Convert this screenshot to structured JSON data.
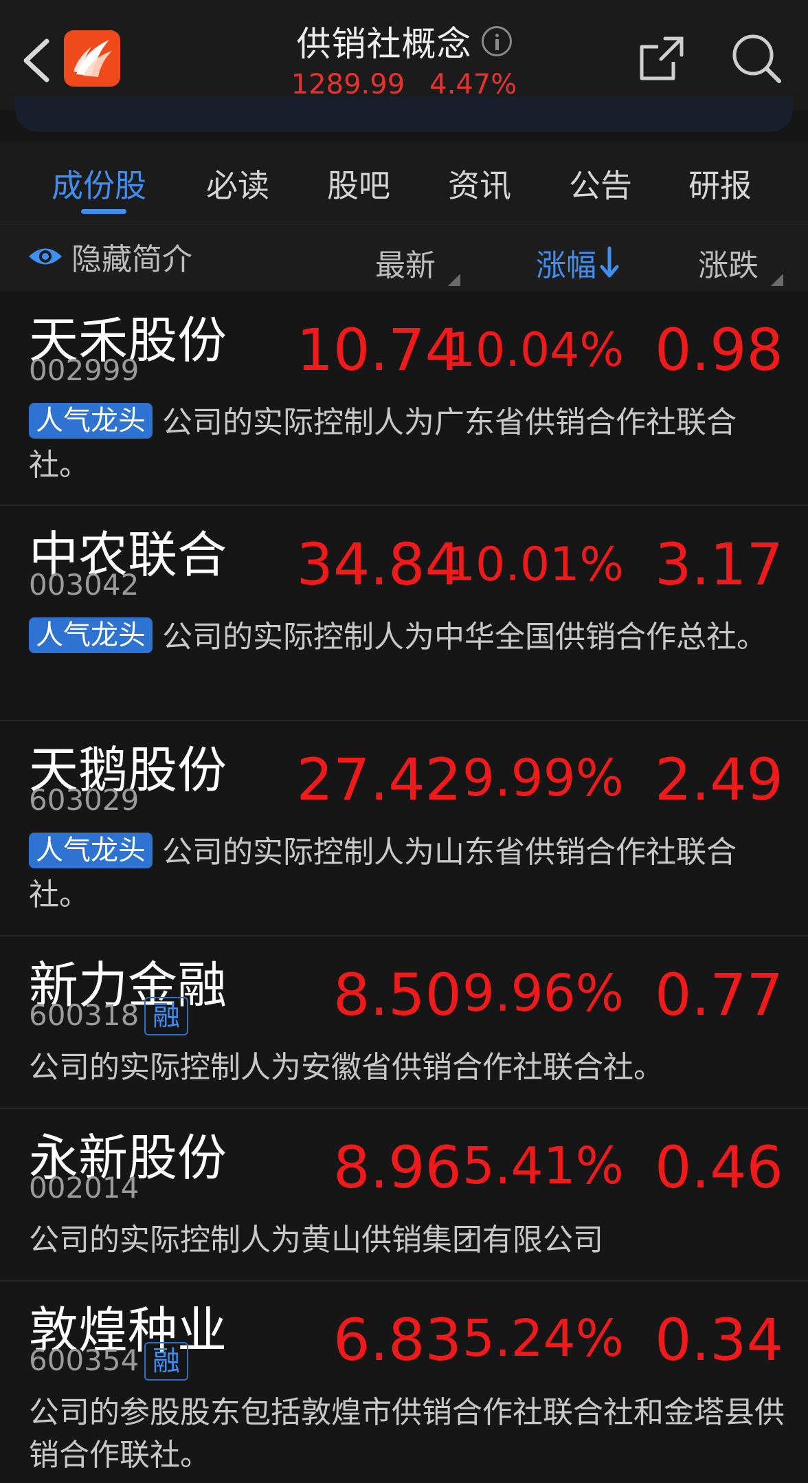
{
  "header": {
    "title": "供销社概念",
    "index_value": "1289.99",
    "index_change_pct": "4.47%"
  },
  "icons": [
    "back-icon",
    "app-logo-icon",
    "info-icon",
    "share-icon",
    "search-icon",
    "eye-icon",
    "sort-down-arrow-icon"
  ],
  "colors": {
    "up_red": "#f01a1a",
    "accent_blue": "#3f8ef0",
    "background": "#161616"
  },
  "tabs": [
    {
      "label": "成份股",
      "active": true
    },
    {
      "label": "必读"
    },
    {
      "label": "股吧"
    },
    {
      "label": "资讯"
    },
    {
      "label": "公告"
    },
    {
      "label": "研报"
    }
  ],
  "columns": {
    "hide_intro": "隐藏简介",
    "latest": "最新",
    "change_pct": "涨幅",
    "change": "涨跌"
  },
  "stocks": [
    {
      "name": "天禾股份",
      "code": "002999",
      "price": "10.74",
      "pct": "10.04%",
      "chg": "0.98",
      "tag": "人气龙头",
      "desc": "公司的实际控制人为广东省供销合作社联合社。"
    },
    {
      "name": "中农联合",
      "code": "003042",
      "price": "34.84",
      "pct": "10.01%",
      "chg": "3.17",
      "tag": "人气龙头",
      "desc": "公司的实际控制人为中华全国供销合作总社。"
    },
    {
      "name": "天鹅股份",
      "code": "603029",
      "price": "27.42",
      "pct": "9.99%",
      "chg": "2.49",
      "tag": "人气龙头",
      "desc": "公司的实际控制人为山东省供销合作社联合社。"
    },
    {
      "name": "新力金融",
      "code": "600318",
      "badge": "融",
      "price": "8.50",
      "pct": "9.96%",
      "chg": "0.77",
      "desc": "公司的实际控制人为安徽省供销合作社联合社。"
    },
    {
      "name": "永新股份",
      "code": "002014",
      "price": "8.96",
      "pct": "5.41%",
      "chg": "0.46",
      "desc": "公司的实际控制人为黄山供销集团有限公司"
    },
    {
      "name": "敦煌种业",
      "code": "600354",
      "badge": "融",
      "price": "6.83",
      "pct": "5.24%",
      "chg": "0.34",
      "desc": "公司的参股股东包括敦煌市供销合作社联合社和金塔县供销合作联社。"
    }
  ]
}
